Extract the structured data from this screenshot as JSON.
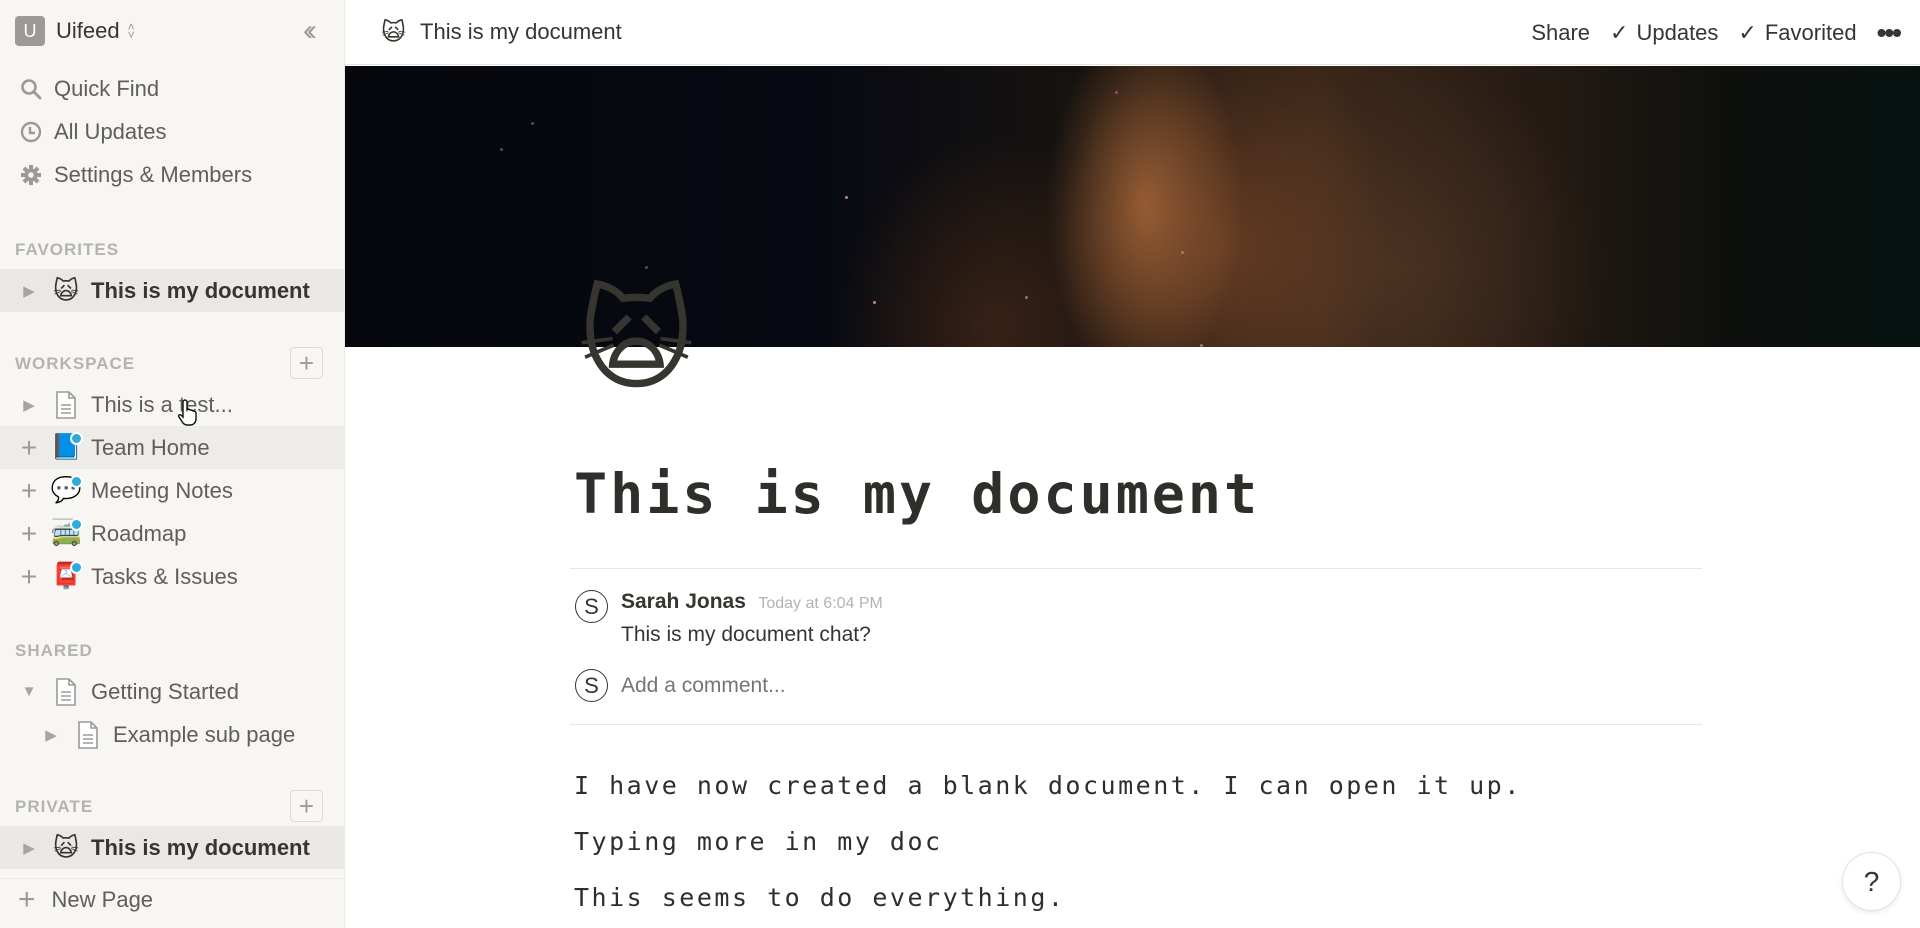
{
  "workspace": {
    "initial": "U",
    "name": "Uifeed"
  },
  "sidebar": {
    "nav": [
      {
        "label": "Quick Find",
        "icon": "search-icon"
      },
      {
        "label": "All Updates",
        "icon": "clock-icon"
      },
      {
        "label": "Settings & Members",
        "icon": "gear-icon"
      }
    ],
    "sections": {
      "favorites": {
        "label": "FAVORITES",
        "items": [
          {
            "emoji": "🙀",
            "label": "This is my document",
            "toggle": "▶"
          }
        ]
      },
      "workspace": {
        "label": "WORKSPACE",
        "items": [
          {
            "icon": "page-icon",
            "label": "This is a test...",
            "toggle": "▶"
          },
          {
            "emoji": "📘",
            "label": "Team Home",
            "toggle": "+",
            "unread": true
          },
          {
            "emoji": "💬",
            "label": "Meeting Notes",
            "toggle": "+",
            "unread": true
          },
          {
            "emoji": "🚎",
            "label": "Roadmap",
            "toggle": "+",
            "unread": true
          },
          {
            "emoji": "📮",
            "label": "Tasks & Issues",
            "toggle": "+",
            "unread": true
          }
        ]
      },
      "shared": {
        "label": "SHARED",
        "items": [
          {
            "icon": "page-icon",
            "label": "Getting Started",
            "toggle": "▼"
          },
          {
            "icon": "page-icon",
            "label": "Example sub page",
            "toggle": "▶"
          }
        ]
      },
      "private": {
        "label": "PRIVATE",
        "items": [
          {
            "emoji": "🙀",
            "label": "This is my document",
            "toggle": "▶"
          }
        ]
      }
    },
    "new_page": {
      "plus": "+",
      "label": "New Page"
    }
  },
  "topbar": {
    "breadcrumb": {
      "emoji": "🙀",
      "title": "This is my document"
    },
    "share": "Share",
    "updates": {
      "check": "✓",
      "label": "Updates"
    },
    "favorited": {
      "check": "✓",
      "label": "Favorited"
    },
    "more": "•••"
  },
  "page": {
    "icon": "🙀",
    "title": "This is my document",
    "comments": [
      {
        "avatar": "S",
        "author": "Sarah Jonas",
        "time": "Today at 6:04 PM",
        "text": "This is my document chat?"
      }
    ],
    "comment_input": {
      "avatar": "S",
      "placeholder": "Add a comment..."
    },
    "body": [
      "I have now created a blank document. I can open it up.",
      "Typing more in my doc",
      "This seems to do everything."
    ]
  },
  "help": {
    "label": "?"
  }
}
